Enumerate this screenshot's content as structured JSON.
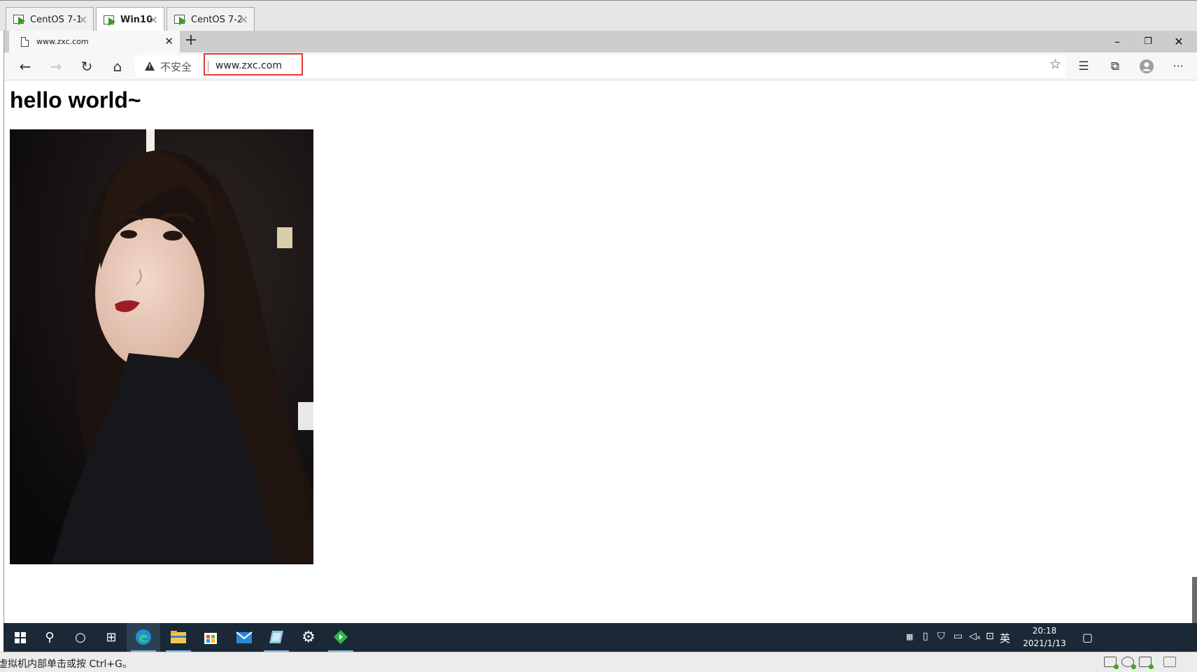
{
  "vm_tabs": [
    {
      "label": "CentOS 7-1",
      "active": false
    },
    {
      "label": "Win10",
      "active": true
    },
    {
      "label": "CentOS 7-2",
      "active": false
    }
  ],
  "browser": {
    "tab_title": "www.zxc.com",
    "security_label": "不安全",
    "url": "www.zxc.com"
  },
  "page": {
    "heading": "hello world~"
  },
  "taskbar": {
    "clock_time": "20:18",
    "clock_date": "2021/1/13",
    "ime_label": "英"
  },
  "statusbar": {
    "message": "虚拟机内部单击或按 Ctrl+G。"
  },
  "colors": {
    "url_highlight": "#e53935",
    "taskbar_bg": "#1b2937",
    "vm_play": "#3a9b1e"
  }
}
